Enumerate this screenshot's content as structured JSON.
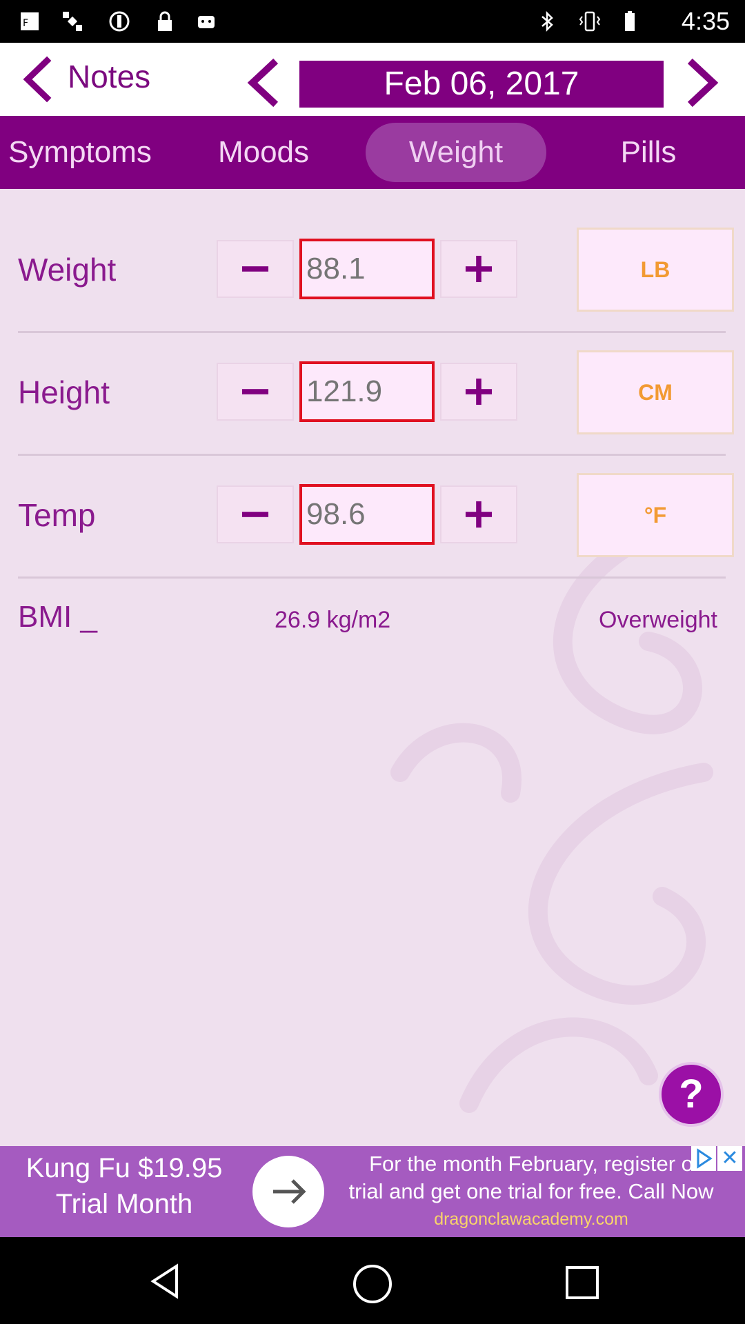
{
  "status_bar": {
    "time": "4:35"
  },
  "header": {
    "notes_label": "Notes",
    "date": "Feb 06, 2017"
  },
  "tabs": [
    {
      "label": "Symptoms",
      "active": false
    },
    {
      "label": "Moods",
      "active": false
    },
    {
      "label": "Weight",
      "active": true
    },
    {
      "label": "Pills",
      "active": false
    }
  ],
  "measurements": {
    "weight": {
      "label": "Weight",
      "placeholder": "88.1",
      "unit": "LB"
    },
    "height": {
      "label": "Height",
      "placeholder": "121.9",
      "unit": "CM"
    },
    "temp": {
      "label": "Temp",
      "placeholder": "98.6",
      "unit": "°F"
    }
  },
  "bmi": {
    "label": "BMI _",
    "value": "26.9 kg/m2",
    "status": "Overweight"
  },
  "help_button": {
    "label": "?"
  },
  "ad": {
    "left_text_line1": "Kung Fu $19.95",
    "left_text_line2": "Trial Month",
    "right_text_line1": "For the month February, register o",
    "right_text_line2": "trial and get one trial for free. Call Now",
    "url": "dragonclawacademy.com",
    "close_label": "✕"
  },
  "colors": {
    "primary_purple": "#800080",
    "background": "#efe0ee",
    "unit_text": "#f29a33",
    "input_border": "#e01020"
  },
  "icons": [
    "fake-gps-icon",
    "satellite-icon",
    "sync-icon",
    "lock-icon",
    "android-icon",
    "bluetooth-icon",
    "vibrate-icon",
    "battery-icon"
  ]
}
